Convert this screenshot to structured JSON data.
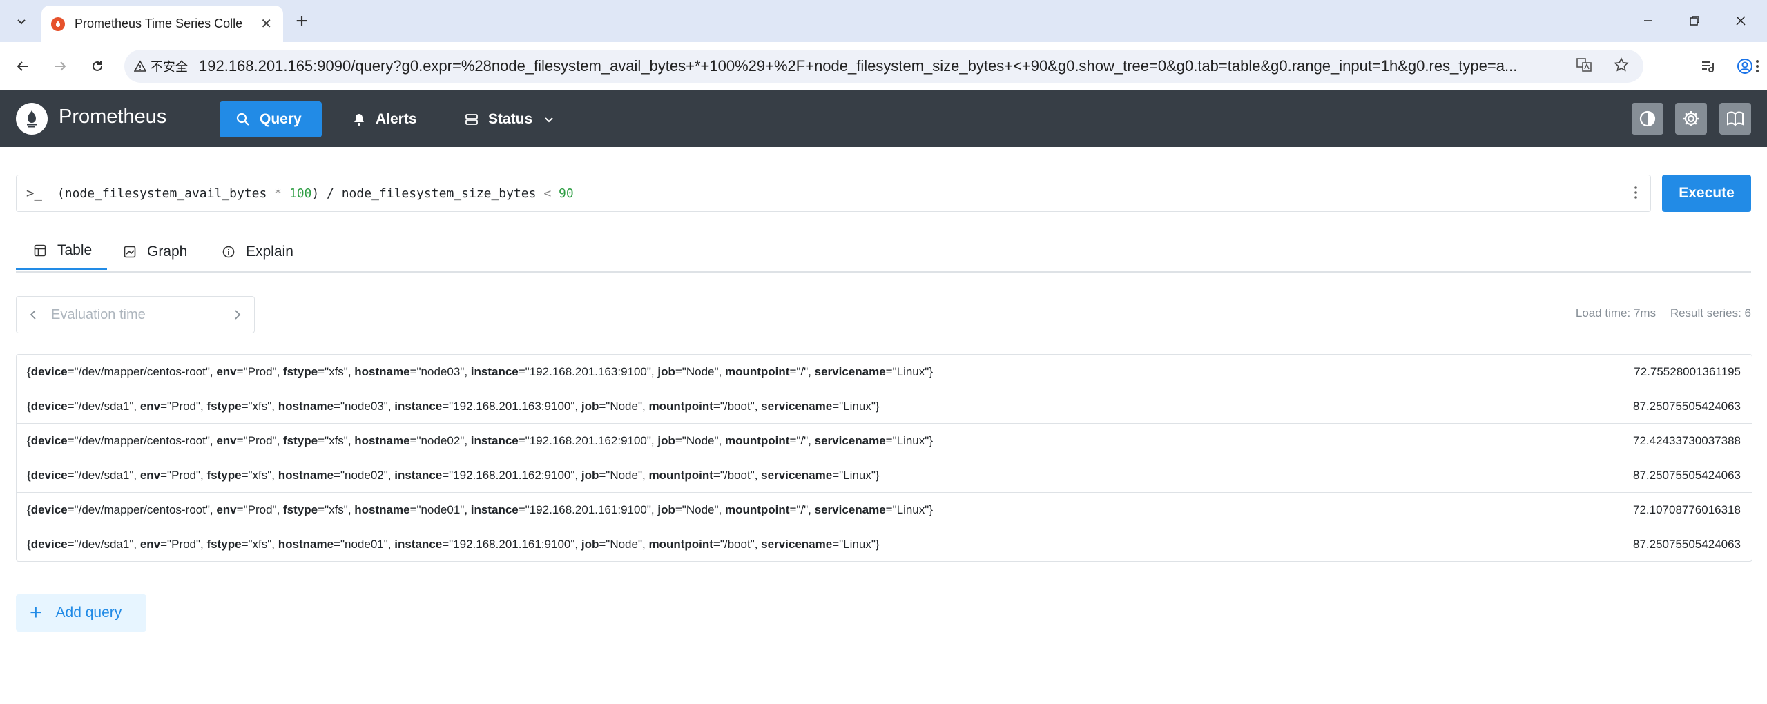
{
  "browser": {
    "tab_title": "Prometheus Time Series Colle",
    "security_label": "不安全",
    "url_host": "192.168.201.165",
    "url_rest": ":9090/query?g0.expr=%28node_filesystem_avail_bytes+*+100%29+%2F+node_filesystem_size_bytes+<+90&g0.show_tree=0&g0.tab=table&g0.range_input=1h&g0.res_type=a..."
  },
  "navbar": {
    "brand": "Prometheus",
    "query": "Query",
    "alerts": "Alerts",
    "status": "Status"
  },
  "query": {
    "prompt": ">_",
    "expr_a": "(node_filesystem_avail_bytes ",
    "expr_op1": "*",
    "expr_b": " ",
    "expr_num1": "100",
    "expr_c": ") / node_filesystem_size_bytes ",
    "expr_op2": "<",
    "expr_d": " ",
    "expr_num2": "90",
    "execute": "Execute"
  },
  "tabs": {
    "table": "Table",
    "graph": "Graph",
    "explain": "Explain"
  },
  "eval": {
    "placeholder": "Evaluation time"
  },
  "stats": {
    "load_time": "Load time: 7ms",
    "result_series": "Result series: 6"
  },
  "results": [
    {
      "device": "/dev/mapper/centos-root",
      "env": "Prod",
      "fstype": "xfs",
      "hostname": "node03",
      "instance": "192.168.201.163:9100",
      "job": "Node",
      "mountpoint": "/",
      "servicename": "Linux",
      "value": "72.75528001361195"
    },
    {
      "device": "/dev/sda1",
      "env": "Prod",
      "fstype": "xfs",
      "hostname": "node03",
      "instance": "192.168.201.163:9100",
      "job": "Node",
      "mountpoint": "/boot",
      "servicename": "Linux",
      "value": "87.25075505424063"
    },
    {
      "device": "/dev/mapper/centos-root",
      "env": "Prod",
      "fstype": "xfs",
      "hostname": "node02",
      "instance": "192.168.201.162:9100",
      "job": "Node",
      "mountpoint": "/",
      "servicename": "Linux",
      "value": "72.42433730037388"
    },
    {
      "device": "/dev/sda1",
      "env": "Prod",
      "fstype": "xfs",
      "hostname": "node02",
      "instance": "192.168.201.162:9100",
      "job": "Node",
      "mountpoint": "/boot",
      "servicename": "Linux",
      "value": "87.25075505424063"
    },
    {
      "device": "/dev/mapper/centos-root",
      "env": "Prod",
      "fstype": "xfs",
      "hostname": "node01",
      "instance": "192.168.201.161:9100",
      "job": "Node",
      "mountpoint": "/",
      "servicename": "Linux",
      "value": "72.10708776016318"
    },
    {
      "device": "/dev/sda1",
      "env": "Prod",
      "fstype": "xfs",
      "hostname": "node01",
      "instance": "192.168.201.161:9100",
      "job": "Node",
      "mountpoint": "/boot",
      "servicename": "Linux",
      "value": "87.25075505424063"
    }
  ],
  "add_query": "Add query",
  "colors": {
    "accent": "#228be6",
    "navbar": "#373e46",
    "label_value": "#212529"
  }
}
